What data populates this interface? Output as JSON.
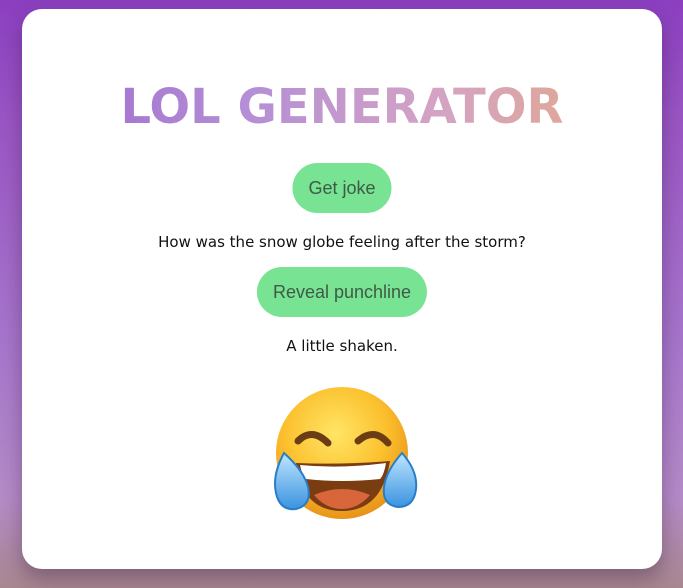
{
  "app": {
    "title": "LOL GENERATOR"
  },
  "buttons": {
    "get_joke": "Get joke",
    "reveal_punchline": "Reveal punchline"
  },
  "joke": {
    "setup": "How was the snow globe feeling after the storm?",
    "punchline": "A little shaken."
  },
  "emoji": {
    "icon": "face-with-tears-of-joy-icon"
  },
  "colors": {
    "button_bg": "#78e392",
    "button_text": "#3f5a47",
    "card_bg": "#ffffff"
  }
}
